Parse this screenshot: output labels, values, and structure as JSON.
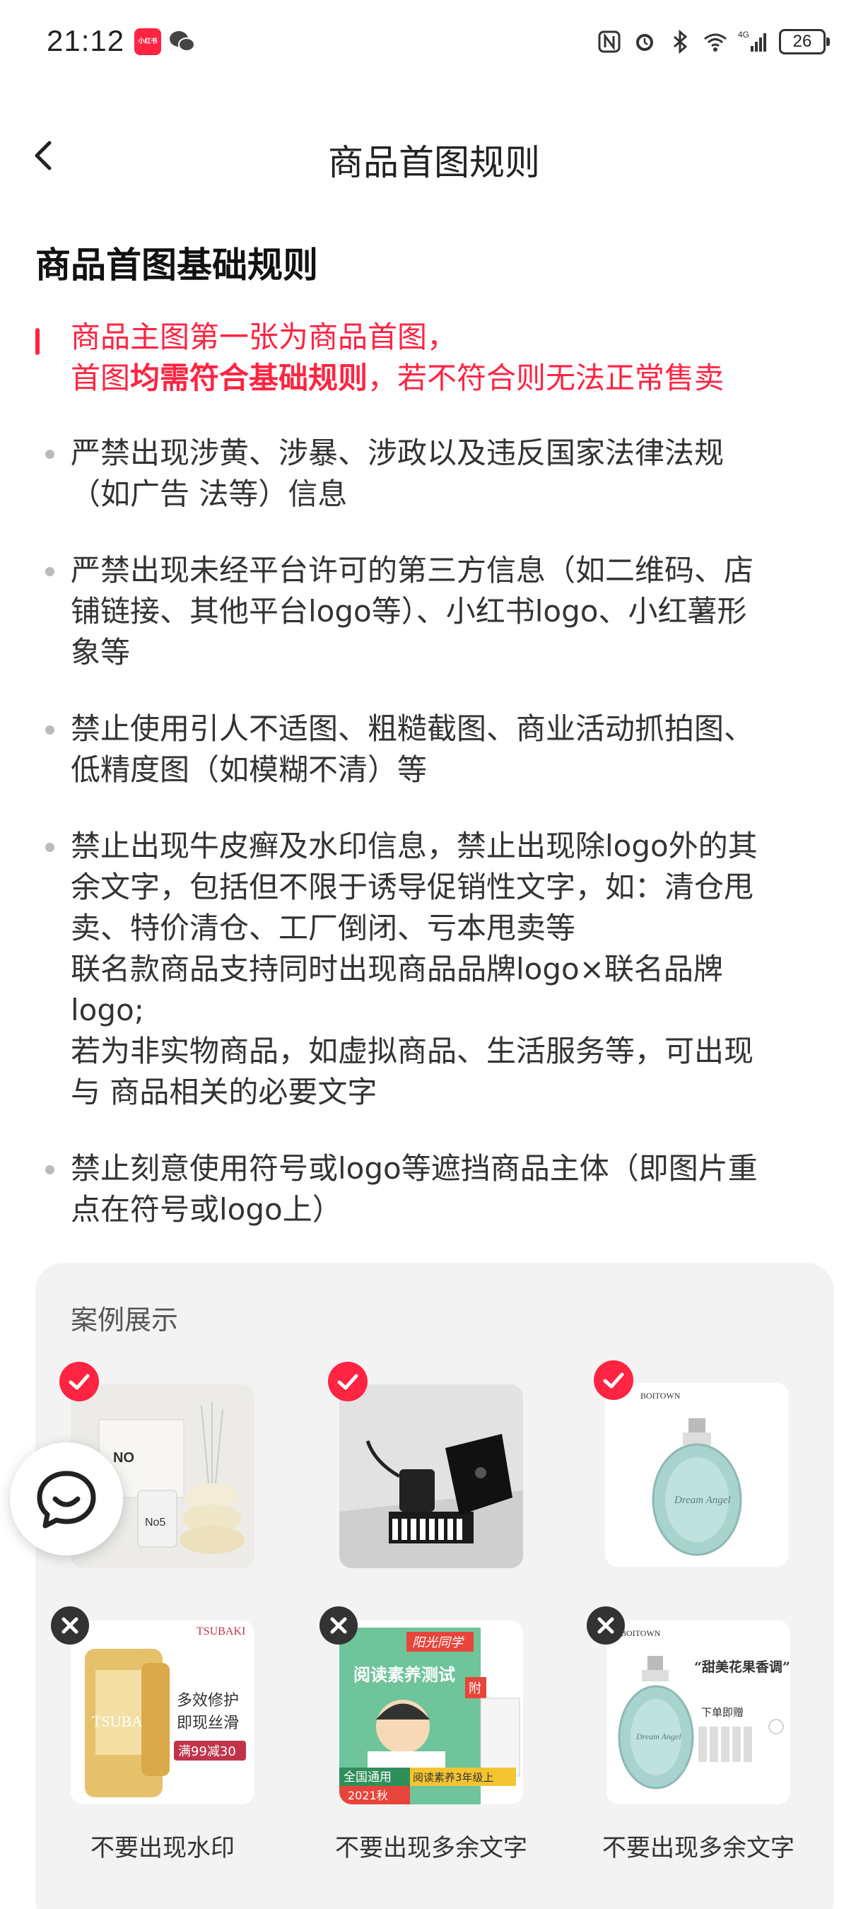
{
  "status_bar": {
    "time": "21:12",
    "app_icon_label": "小红书",
    "battery": "26",
    "icons": [
      "nfc-icon",
      "alarm-icon",
      "bluetooth-icon",
      "wifi-icon",
      "signal-4g-icon",
      "battery-icon"
    ]
  },
  "nav": {
    "title": "商品首图规则"
  },
  "section_title": "商品首图基础规则",
  "highlight": {
    "line1": "商品主图第一张为商品首图，",
    "line2_pre": "首图",
    "line2_bold": "均需符合基础规则",
    "line2_post": "，若不符合则无法正常售卖"
  },
  "rules": [
    {
      "lines": [
        "严禁出现涉黄、涉暴、涉政以及违反国家法律法规",
        "（如广告 法等）信息"
      ]
    },
    {
      "lines": [
        "严禁出现未经平台许可的第三方信息（如二维码、店",
        "铺链接、其他平台logo等）、小红书logo、小红薯形",
        "象等"
      ]
    },
    {
      "lines": [
        "禁止使用引人不适图、粗糙截图、商业活动抓拍图、",
        "低精度图（如模糊不清）等"
      ]
    },
    {
      "lines": [
        "禁止出现牛皮癣及水印信息，禁止出现除logo外的其",
        "余文字，包括但不限于诱导促销性文字，如：清仓甩",
        "卖、特价清仓、工厂倒闭、亏本甩卖等",
        "联名款商品支持同时出现商品品牌logo×联名品牌",
        "logo;",
        "若为非实物商品，如虚拟商品、生活服务等，可出现",
        "与 商品相关的必要文字"
      ]
    },
    {
      "lines": [
        "禁止刻意使用符号或logo等遮挡商品主体（即图片重",
        "点在符号或logo上）"
      ]
    }
  ],
  "examples": {
    "title": "案例展示",
    "good": [
      {
        "status": "ok",
        "image_text": "NO",
        "image_text2": "No5"
      },
      {
        "status": "ok"
      },
      {
        "status": "ok",
        "image_text": "BOITOWN",
        "image_text2": "Dream Angel"
      }
    ],
    "bad": [
      {
        "status": "no",
        "caption": "不要出现水印",
        "image_text": "TSUBAKI",
        "overlay1": "多效修护",
        "overlay2": "即现丝滑",
        "promo": "满99减30"
      },
      {
        "status": "no",
        "caption": "不要出现多余文字",
        "image_text": "阳光同学",
        "overlay1": "阅读素养测试",
        "overlay2": "全国通用",
        "overlay3": "阅读素养3年级上",
        "badge_text": "附",
        "year": "2021秋"
      },
      {
        "status": "no",
        "caption": "不要出现多余文字",
        "image_text": "BOITOWN",
        "overlay1": "“甜美花果香调”",
        "overlay2": "下单即赠",
        "image_text2": "Dream Angel"
      }
    ]
  },
  "colors": {
    "accent": "#ff2442",
    "text": "#333333",
    "panel": "#f3f3f3"
  }
}
